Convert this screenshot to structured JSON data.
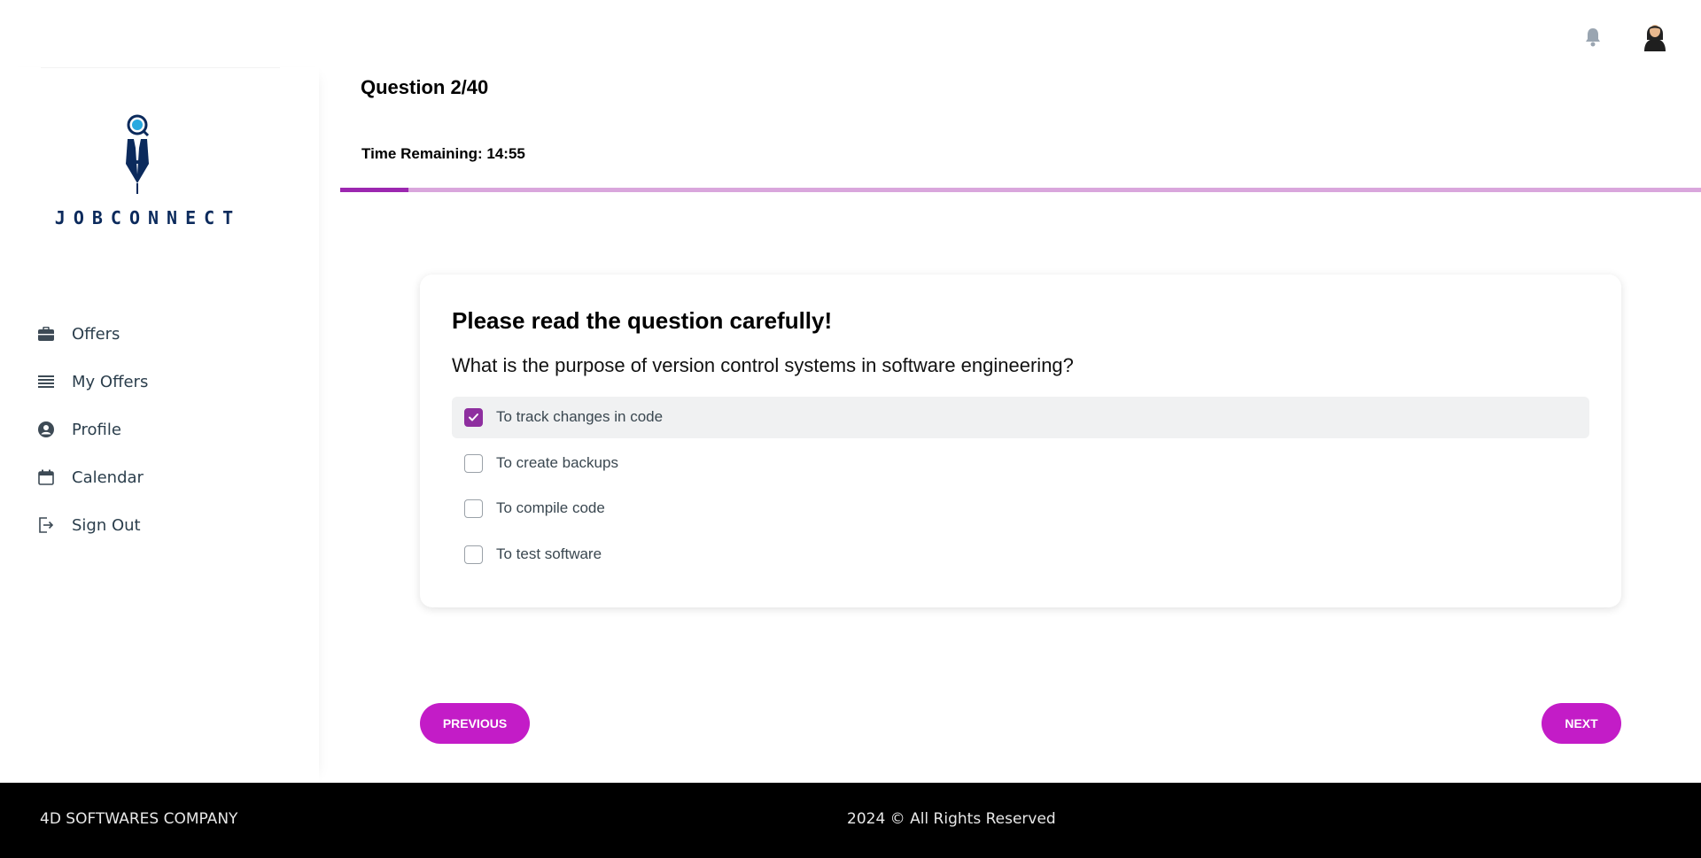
{
  "header": {
    "notifications_icon": "bell-icon",
    "avatar_icon": "user-avatar-icon"
  },
  "sidebar": {
    "logo_text": "JOBCONNECT",
    "items": [
      {
        "label": "Offers",
        "icon": "briefcase-icon"
      },
      {
        "label": "My Offers",
        "icon": "list-icon"
      },
      {
        "label": "Profile",
        "icon": "user-circle-icon"
      },
      {
        "label": "Calendar",
        "icon": "calendar-icon"
      },
      {
        "label": "Sign Out",
        "icon": "sign-out-icon"
      }
    ]
  },
  "quiz": {
    "counter": "Question 2/40",
    "timer": "Time Remaining: 14:55",
    "progress_fraction": 0.05,
    "title": "Please read the question carefully!",
    "question": "What is the purpose of version control systems in software engineering?",
    "options": [
      {
        "label": "To track changes in code",
        "checked": true
      },
      {
        "label": "To create backups",
        "checked": false
      },
      {
        "label": "To compile code",
        "checked": false
      },
      {
        "label": "To test software",
        "checked": false
      }
    ],
    "previous_label": "PREVIOUS",
    "next_label": "NEXT"
  },
  "footer": {
    "company": "4D SOFTWARES COMPANY",
    "copyright": "2024 © All Rights Reserved"
  },
  "colors": {
    "accent": "#c31cc7",
    "progress_fill": "#9c27b0",
    "progress_track": "#d9a6dc",
    "checkbox_checked": "#8e2f9f",
    "footer_bg": "#000000",
    "logo_navy": "#0b2a5c"
  }
}
